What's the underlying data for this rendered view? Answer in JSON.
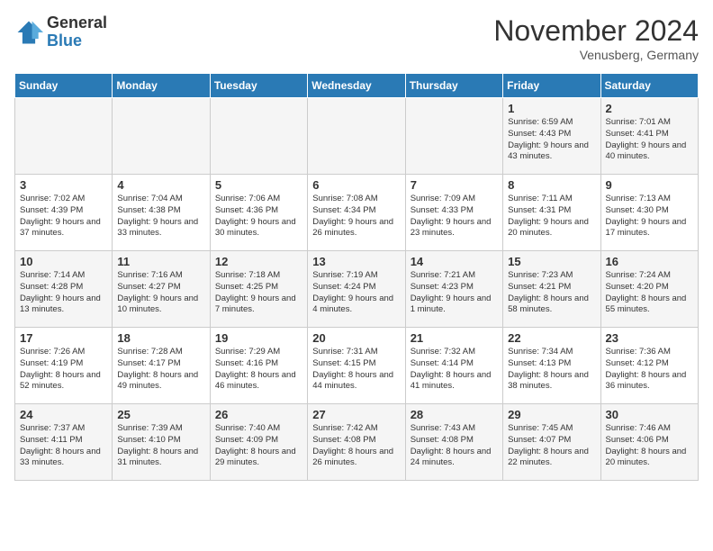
{
  "logo": {
    "general": "General",
    "blue": "Blue"
  },
  "header": {
    "month": "November 2024",
    "location": "Venusberg, Germany"
  },
  "weekdays": [
    "Sunday",
    "Monday",
    "Tuesday",
    "Wednesday",
    "Thursday",
    "Friday",
    "Saturday"
  ],
  "weeks": [
    [
      {
        "day": "",
        "info": ""
      },
      {
        "day": "",
        "info": ""
      },
      {
        "day": "",
        "info": ""
      },
      {
        "day": "",
        "info": ""
      },
      {
        "day": "",
        "info": ""
      },
      {
        "day": "1",
        "info": "Sunrise: 6:59 AM\nSunset: 4:43 PM\nDaylight: 9 hours\nand 43 minutes."
      },
      {
        "day": "2",
        "info": "Sunrise: 7:01 AM\nSunset: 4:41 PM\nDaylight: 9 hours\nand 40 minutes."
      }
    ],
    [
      {
        "day": "3",
        "info": "Sunrise: 7:02 AM\nSunset: 4:39 PM\nDaylight: 9 hours\nand 37 minutes."
      },
      {
        "day": "4",
        "info": "Sunrise: 7:04 AM\nSunset: 4:38 PM\nDaylight: 9 hours\nand 33 minutes."
      },
      {
        "day": "5",
        "info": "Sunrise: 7:06 AM\nSunset: 4:36 PM\nDaylight: 9 hours\nand 30 minutes."
      },
      {
        "day": "6",
        "info": "Sunrise: 7:08 AM\nSunset: 4:34 PM\nDaylight: 9 hours\nand 26 minutes."
      },
      {
        "day": "7",
        "info": "Sunrise: 7:09 AM\nSunset: 4:33 PM\nDaylight: 9 hours\nand 23 minutes."
      },
      {
        "day": "8",
        "info": "Sunrise: 7:11 AM\nSunset: 4:31 PM\nDaylight: 9 hours\nand 20 minutes."
      },
      {
        "day": "9",
        "info": "Sunrise: 7:13 AM\nSunset: 4:30 PM\nDaylight: 9 hours\nand 17 minutes."
      }
    ],
    [
      {
        "day": "10",
        "info": "Sunrise: 7:14 AM\nSunset: 4:28 PM\nDaylight: 9 hours\nand 13 minutes."
      },
      {
        "day": "11",
        "info": "Sunrise: 7:16 AM\nSunset: 4:27 PM\nDaylight: 9 hours\nand 10 minutes."
      },
      {
        "day": "12",
        "info": "Sunrise: 7:18 AM\nSunset: 4:25 PM\nDaylight: 9 hours\nand 7 minutes."
      },
      {
        "day": "13",
        "info": "Sunrise: 7:19 AM\nSunset: 4:24 PM\nDaylight: 9 hours\nand 4 minutes."
      },
      {
        "day": "14",
        "info": "Sunrise: 7:21 AM\nSunset: 4:23 PM\nDaylight: 9 hours\nand 1 minute."
      },
      {
        "day": "15",
        "info": "Sunrise: 7:23 AM\nSunset: 4:21 PM\nDaylight: 8 hours\nand 58 minutes."
      },
      {
        "day": "16",
        "info": "Sunrise: 7:24 AM\nSunset: 4:20 PM\nDaylight: 8 hours\nand 55 minutes."
      }
    ],
    [
      {
        "day": "17",
        "info": "Sunrise: 7:26 AM\nSunset: 4:19 PM\nDaylight: 8 hours\nand 52 minutes."
      },
      {
        "day": "18",
        "info": "Sunrise: 7:28 AM\nSunset: 4:17 PM\nDaylight: 8 hours\nand 49 minutes."
      },
      {
        "day": "19",
        "info": "Sunrise: 7:29 AM\nSunset: 4:16 PM\nDaylight: 8 hours\nand 46 minutes."
      },
      {
        "day": "20",
        "info": "Sunrise: 7:31 AM\nSunset: 4:15 PM\nDaylight: 8 hours\nand 44 minutes."
      },
      {
        "day": "21",
        "info": "Sunrise: 7:32 AM\nSunset: 4:14 PM\nDaylight: 8 hours\nand 41 minutes."
      },
      {
        "day": "22",
        "info": "Sunrise: 7:34 AM\nSunset: 4:13 PM\nDaylight: 8 hours\nand 38 minutes."
      },
      {
        "day": "23",
        "info": "Sunrise: 7:36 AM\nSunset: 4:12 PM\nDaylight: 8 hours\nand 36 minutes."
      }
    ],
    [
      {
        "day": "24",
        "info": "Sunrise: 7:37 AM\nSunset: 4:11 PM\nDaylight: 8 hours\nand 33 minutes."
      },
      {
        "day": "25",
        "info": "Sunrise: 7:39 AM\nSunset: 4:10 PM\nDaylight: 8 hours\nand 31 minutes."
      },
      {
        "day": "26",
        "info": "Sunrise: 7:40 AM\nSunset: 4:09 PM\nDaylight: 8 hours\nand 29 minutes."
      },
      {
        "day": "27",
        "info": "Sunrise: 7:42 AM\nSunset: 4:08 PM\nDaylight: 8 hours\nand 26 minutes."
      },
      {
        "day": "28",
        "info": "Sunrise: 7:43 AM\nSunset: 4:08 PM\nDaylight: 8 hours\nand 24 minutes."
      },
      {
        "day": "29",
        "info": "Sunrise: 7:45 AM\nSunset: 4:07 PM\nDaylight: 8 hours\nand 22 minutes."
      },
      {
        "day": "30",
        "info": "Sunrise: 7:46 AM\nSunset: 4:06 PM\nDaylight: 8 hours\nand 20 minutes."
      }
    ]
  ]
}
